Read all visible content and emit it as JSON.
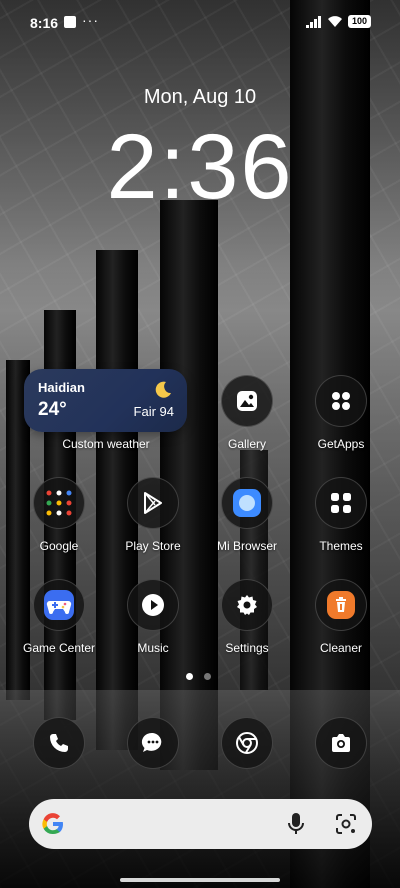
{
  "status_bar": {
    "time": "8:16",
    "overflow": "···",
    "battery": "100"
  },
  "lockscreen": {
    "date": "Mon, Aug 10",
    "clock": "2:36"
  },
  "weather_widget": {
    "city": "Haidian",
    "temperature": "24°",
    "condition": "Fair 94",
    "label": "Custom weather"
  },
  "apps": {
    "gallery": "Gallery",
    "getapps": "GetApps",
    "google": "Google",
    "play_store": "Play Store",
    "mi_browser": "Mi Browser",
    "themes": "Themes",
    "game_center": "Game Center",
    "music": "Music",
    "settings": "Settings",
    "cleaner": "Cleaner"
  },
  "page_indicator": {
    "pages": 2,
    "current": 1
  },
  "dock": [
    "phone-icon",
    "messages-icon",
    "chrome-icon",
    "camera-icon"
  ],
  "search_bar": {
    "logo": "google-g-icon",
    "icons": [
      "mic-icon",
      "lens-icon"
    ]
  },
  "colors": {
    "weather_widget_bg": "#22325a",
    "game_center_accent": "#3b6df0",
    "mi_browser_accent": "#3d8bff",
    "cleaner_accent": "#f07a2b",
    "moon": "#f5c84a"
  }
}
